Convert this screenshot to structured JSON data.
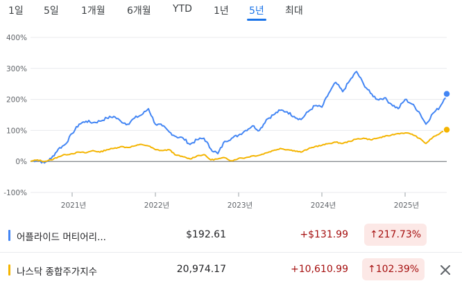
{
  "tabs": [
    {
      "label": "1일",
      "active": false
    },
    {
      "label": "5일",
      "active": false
    },
    {
      "label": "1개월",
      "active": false
    },
    {
      "label": "6개월",
      "active": false
    },
    {
      "label": "YTD",
      "active": false
    },
    {
      "label": "1년",
      "active": false
    },
    {
      "label": "5년",
      "active": true
    },
    {
      "label": "최대",
      "active": false
    }
  ],
  "chart_data": {
    "type": "line",
    "y_ticks": [
      "400%",
      "300%",
      "200%",
      "100%",
      "0%",
      "-100%"
    ],
    "ylim": [
      -100,
      400
    ],
    "x_ticks": [
      "2021년",
      "2022년",
      "2023년",
      "2024년",
      "2025년"
    ],
    "xlim": [
      "2020-07",
      "2025-07"
    ],
    "grid": true,
    "series": [
      {
        "name": "어플라이드 머티어리...",
        "color": "#4285f4",
        "points": [
          [
            "2020-07",
            0
          ],
          [
            "2020-08",
            5
          ],
          [
            "2020-09",
            -5
          ],
          [
            "2020-10",
            10
          ],
          [
            "2020-11",
            40
          ],
          [
            "2020-12",
            55
          ],
          [
            "2021-01",
            90
          ],
          [
            "2021-02",
            120
          ],
          [
            "2021-03",
            130
          ],
          [
            "2021-04",
            125
          ],
          [
            "2021-05",
            130
          ],
          [
            "2021-06",
            140
          ],
          [
            "2021-07",
            145
          ],
          [
            "2021-08",
            130
          ],
          [
            "2021-09",
            120
          ],
          [
            "2021-10",
            140
          ],
          [
            "2021-11",
            150
          ],
          [
            "2021-12",
            170
          ],
          [
            "2022-01",
            120
          ],
          [
            "2022-02",
            115
          ],
          [
            "2022-03",
            95
          ],
          [
            "2022-04",
            80
          ],
          [
            "2022-05",
            75
          ],
          [
            "2022-06",
            55
          ],
          [
            "2022-07",
            70
          ],
          [
            "2022-08",
            75
          ],
          [
            "2022-09",
            40
          ],
          [
            "2022-10",
            25
          ],
          [
            "2022-11",
            65
          ],
          [
            "2022-12",
            75
          ],
          [
            "2023-01",
            85
          ],
          [
            "2023-02",
            100
          ],
          [
            "2023-03",
            115
          ],
          [
            "2023-04",
            100
          ],
          [
            "2023-05",
            135
          ],
          [
            "2023-06",
            150
          ],
          [
            "2023-07",
            165
          ],
          [
            "2023-08",
            160
          ],
          [
            "2023-09",
            145
          ],
          [
            "2023-10",
            135
          ],
          [
            "2023-11",
            160
          ],
          [
            "2023-12",
            180
          ],
          [
            "2024-01",
            175
          ],
          [
            "2024-02",
            220
          ],
          [
            "2024-03",
            255
          ],
          [
            "2024-04",
            225
          ],
          [
            "2024-05",
            260
          ],
          [
            "2024-06",
            290
          ],
          [
            "2024-07",
            250
          ],
          [
            "2024-08",
            220
          ],
          [
            "2024-09",
            200
          ],
          [
            "2024-10",
            205
          ],
          [
            "2024-11",
            185
          ],
          [
            "2024-12",
            170
          ],
          [
            "2025-01",
            200
          ],
          [
            "2025-02",
            185
          ],
          [
            "2025-03",
            160
          ],
          [
            "2025-04",
            120
          ],
          [
            "2025-05",
            155
          ],
          [
            "2025-06",
            175
          ],
          [
            "2025-07",
            217.73
          ]
        ]
      },
      {
        "name": "나스닥 종합주가지수",
        "color": "#f4b400",
        "points": [
          [
            "2020-07",
            0
          ],
          [
            "2020-08",
            5
          ],
          [
            "2020-09",
            0
          ],
          [
            "2020-10",
            5
          ],
          [
            "2020-11",
            15
          ],
          [
            "2020-12",
            22
          ],
          [
            "2021-01",
            25
          ],
          [
            "2021-02",
            30
          ],
          [
            "2021-03",
            28
          ],
          [
            "2021-04",
            35
          ],
          [
            "2021-05",
            30
          ],
          [
            "2021-06",
            38
          ],
          [
            "2021-07",
            42
          ],
          [
            "2021-08",
            48
          ],
          [
            "2021-09",
            45
          ],
          [
            "2021-10",
            50
          ],
          [
            "2021-11",
            55
          ],
          [
            "2021-12",
            50
          ],
          [
            "2022-01",
            38
          ],
          [
            "2022-02",
            35
          ],
          [
            "2022-03",
            38
          ],
          [
            "2022-04",
            20
          ],
          [
            "2022-05",
            15
          ],
          [
            "2022-06",
            8
          ],
          [
            "2022-07",
            18
          ],
          [
            "2022-08",
            22
          ],
          [
            "2022-09",
            5
          ],
          [
            "2022-10",
            8
          ],
          [
            "2022-11",
            12
          ],
          [
            "2022-12",
            2
          ],
          [
            "2023-01",
            10
          ],
          [
            "2023-02",
            12
          ],
          [
            "2023-03",
            18
          ],
          [
            "2023-04",
            20
          ],
          [
            "2023-05",
            28
          ],
          [
            "2023-06",
            35
          ],
          [
            "2023-07",
            42
          ],
          [
            "2023-08",
            38
          ],
          [
            "2023-09",
            35
          ],
          [
            "2023-10",
            30
          ],
          [
            "2023-11",
            40
          ],
          [
            "2023-12",
            48
          ],
          [
            "2024-01",
            52
          ],
          [
            "2024-02",
            58
          ],
          [
            "2024-03",
            62
          ],
          [
            "2024-04",
            58
          ],
          [
            "2024-05",
            65
          ],
          [
            "2024-06",
            72
          ],
          [
            "2024-07",
            75
          ],
          [
            "2024-08",
            70
          ],
          [
            "2024-09",
            75
          ],
          [
            "2024-10",
            80
          ],
          [
            "2024-11",
            85
          ],
          [
            "2024-12",
            90
          ],
          [
            "2025-01",
            92
          ],
          [
            "2025-02",
            88
          ],
          [
            "2025-03",
            75
          ],
          [
            "2025-04",
            58
          ],
          [
            "2025-05",
            78
          ],
          [
            "2025-06",
            90
          ],
          [
            "2025-07",
            102.39
          ]
        ]
      }
    ]
  },
  "rows": [
    {
      "name": "어플라이드 머티어리...",
      "price": "$192.61",
      "change": "+$131.99",
      "pct": "217.73%",
      "arrow": "↑",
      "color": "#4285f4"
    },
    {
      "name": "나스닥 종합주가지수",
      "price": "20,974.17",
      "change": "+10,610.99",
      "pct": "102.39%",
      "arrow": "↑",
      "color": "#f4b400"
    }
  ],
  "icons": {
    "close": "close-icon",
    "arrow": "arrow-up-icon"
  }
}
